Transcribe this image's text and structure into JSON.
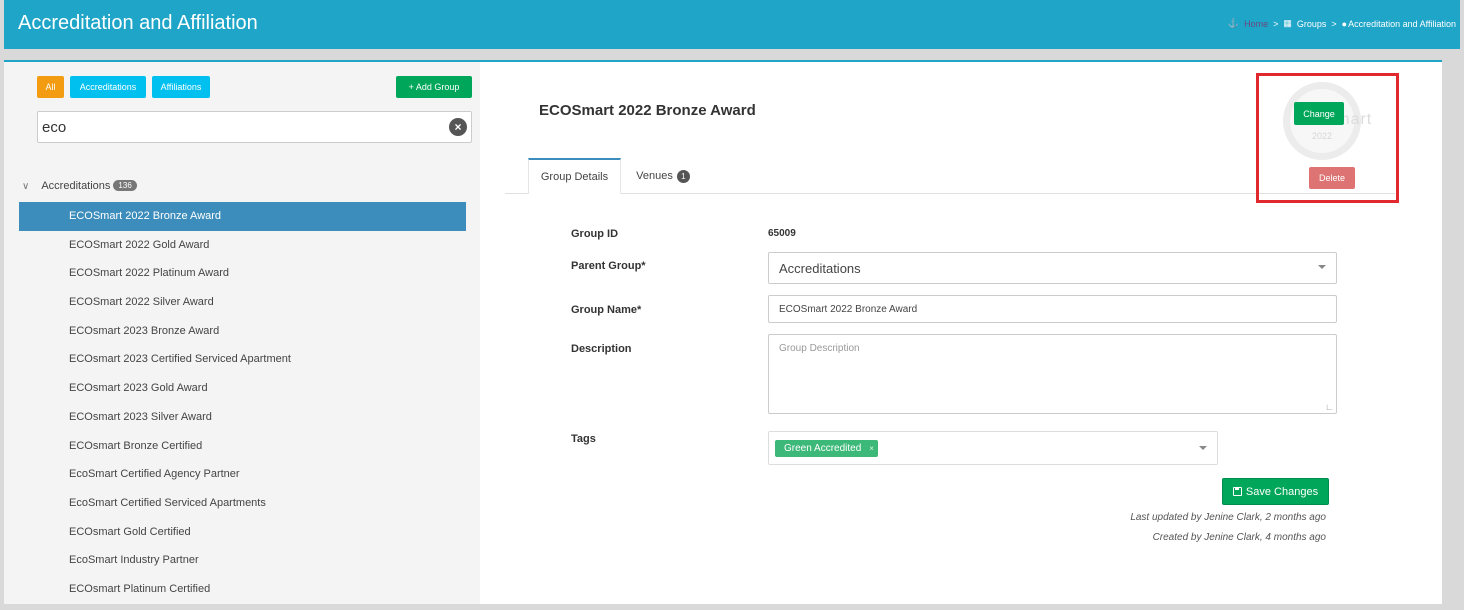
{
  "header": {
    "title": "Accreditation and Affiliation",
    "breadcrumb": {
      "home": "Home",
      "groups": "Groups",
      "current": "Accreditation and Affiliation",
      "separator": ">"
    }
  },
  "filters": {
    "all": "All",
    "accreditations": "Accreditations",
    "affiliations": "Affiliations",
    "add_group": "+ Add Group"
  },
  "search": {
    "value": "eco"
  },
  "tree": {
    "root_label": "Accreditations",
    "root_count": "136",
    "items": [
      {
        "label": "ECOSmart 2022 Bronze Award",
        "active": true
      },
      {
        "label": "ECOSmart 2022 Gold Award"
      },
      {
        "label": "ECOSmart 2022 Platinum Award"
      },
      {
        "label": "ECOSmart 2022 Silver Award"
      },
      {
        "label": "ECOsmart 2023 Bronze Award"
      },
      {
        "label": "ECOsmart 2023 Certified Serviced Apartment"
      },
      {
        "label": "ECOsmart 2023 Gold Award"
      },
      {
        "label": "ECOsmart 2023 Silver Award"
      },
      {
        "label": "ECOsmart Bronze Certified"
      },
      {
        "label": "EcoSmart Certified Agency Partner"
      },
      {
        "label": "EcoSmart Certified Serviced Apartments"
      },
      {
        "label": "ECOsmart Gold Certified"
      },
      {
        "label": "EcoSmart Industry Partner"
      },
      {
        "label": "ECOsmart Platinum Certified"
      }
    ]
  },
  "detail": {
    "title": "ECOSmart 2022 Bronze Award",
    "tabs": {
      "group_details": "Group Details",
      "venues": "Venues",
      "venues_count": "1"
    },
    "group_id_label": "Group ID",
    "group_id": "65009",
    "parent_group_label": "Parent Group*",
    "parent_group": "Accreditations",
    "group_name_label": "Group Name*",
    "group_name": "ECOSmart 2022 Bronze Award",
    "description_label": "Description",
    "description_placeholder": "Group Description",
    "tags_label": "Tags",
    "tags": [
      {
        "label": "Green Accredited",
        "remove": "×"
      }
    ],
    "save_label": "Save Changes",
    "last_updated": "Last updated by Jenine Clark, 2 months ago",
    "created": "Created by Jenine Clark, 4 months ago"
  },
  "image": {
    "change_label": "Change",
    "delete_label": "Delete",
    "logo_text": "EcoSmart",
    "logo_year": "2022"
  },
  "colors": {
    "header": "#1ea5c8",
    "active_item": "#3c8dbc",
    "green": "#00a65a",
    "orange": "#f39c12",
    "cyan": "#00c0ef",
    "highlight_box": "#e0282e",
    "delete": "#dd7373"
  }
}
